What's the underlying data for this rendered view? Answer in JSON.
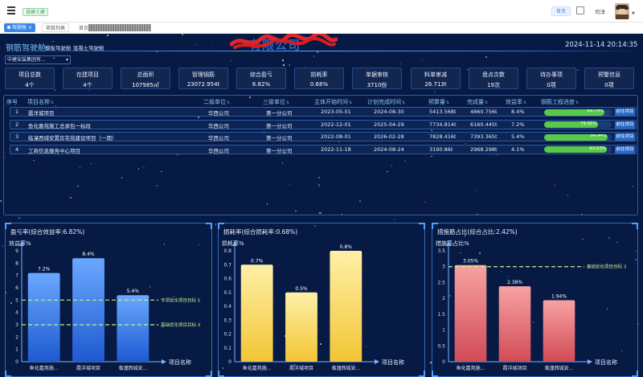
{
  "topbar": {
    "badge": "慧建士建",
    "home": "首页",
    "user": "司洋"
  },
  "tabs": {
    "active": "驾驶舱",
    "list": "项目列表",
    "breadcrumb": "首页 /"
  },
  "header": {
    "title": "钢筋驾驶舱",
    "subtitle": "模板驾驶舱  混凝土驾驶舱",
    "company": "有限公司",
    "time": "2024-11-14 20:14:35"
  },
  "org_select": {
    "value": "中建安装集团有..."
  },
  "kpis": [
    {
      "label": "项目总数",
      "value": "4个"
    },
    {
      "label": "在建项目",
      "value": "4个"
    },
    {
      "label": "总面积",
      "value": "107985㎡"
    },
    {
      "label": "管理钢筋",
      "value": "23072.954t"
    },
    {
      "label": "综合盈亏",
      "value": "6.82%"
    },
    {
      "label": "损耗率",
      "value": "0.68%"
    },
    {
      "label": "单据审核",
      "value": "3710份"
    },
    {
      "label": "料单审减",
      "value": "26.713t"
    },
    {
      "label": "盘点次数",
      "value": "19次"
    },
    {
      "label": "待办事项",
      "value": "0项"
    },
    {
      "label": "预警信息",
      "value": "0项"
    }
  ],
  "table": {
    "headers": {
      "no": "序号",
      "name": "项目名称",
      "unit2": "二级单位",
      "unit3": "三级单位",
      "start": "主体开始时间",
      "plan": "计划完成时间",
      "budget": "预算量",
      "done": "完成量",
      "rate": "效益率",
      "progress": "钢筋工程进度"
    },
    "goto_label": "前往项目",
    "rows": [
      {
        "no": "1",
        "name": "霞洋城项目",
        "unit2": "华西公司",
        "unit3": "第一分公司",
        "start": "2023-05-01",
        "plan": "2024-08-30",
        "budget": "5413.568t",
        "done": "4860.756t",
        "rate": "8.4%",
        "progress": 89.79,
        "progress_text": "89.79%"
      },
      {
        "no": "2",
        "name": "鱼化嘉苑施工总承包一标段",
        "unit2": "华西公司",
        "unit3": "第一分公司",
        "start": "2022-12-01",
        "plan": "2025-04-29",
        "budget": "7734.814t",
        "done": "6160.445t",
        "rate": "7.2%",
        "progress": 79.65,
        "progress_text": "79.65%"
      },
      {
        "no": "3",
        "name": "临潼西城安置房花苑建设项目（一期）",
        "unit2": "华西公司",
        "unit3": "第一分公司",
        "start": "2022-08-01",
        "plan": "2026-02-28",
        "budget": "7828.416t",
        "done": "7393.365t",
        "rate": "5.4%",
        "progress": 94.44,
        "progress_text": "94.44%"
      },
      {
        "no": "4",
        "name": "工商信息服务中心项目",
        "unit2": "华西公司",
        "unit3": "第一分公司",
        "start": "2022-11-18",
        "plan": "2024-08-24",
        "budget": "3190.86t",
        "done": "2968.298t",
        "rate": "4.1%",
        "progress": 93.03,
        "progress_text": "93.03%"
      }
    ]
  },
  "chart_data": [
    {
      "type": "bar",
      "title": "盈亏率(综合效益率:6.82%)",
      "ylabel": "效益率%",
      "xlabel": "项目名称",
      "categories": [
        "鱼化嘉苑施...",
        "霞洋城项目",
        "临潼西城安..."
      ],
      "values": [
        7.2,
        8.4,
        5.4
      ],
      "value_labels": [
        "7.2%",
        "8.4%",
        "5.4%"
      ],
      "ylim": [
        0,
        9
      ],
      "ticks": [
        0,
        1,
        2,
        3,
        4,
        5,
        6,
        7,
        8,
        9
      ],
      "ref_lines": [
        {
          "value": 5,
          "label": "专项优化项目目标 5"
        },
        {
          "value": 3,
          "label": "基础优化项目目标 3"
        }
      ],
      "bar_top": "#6aa8ff",
      "bar_bottom": "#1e5ad0",
      "ref_color": "#c6f08a"
    },
    {
      "type": "bar",
      "title": "损耗率(综合损耗率:0.68%)",
      "ylabel": "损耗率%",
      "xlabel": "项目名称",
      "categories": [
        "鱼化嘉苑施...",
        "霞洋城项目",
        "临潼西城安..."
      ],
      "values": [
        0.7,
        0.5,
        0.8
      ],
      "value_labels": [
        "0.7%",
        "0.5%",
        "0.8%"
      ],
      "ylim": [
        0,
        0.8
      ],
      "ticks": [
        0,
        0.1,
        0.2,
        0.3,
        0.4,
        0.5,
        0.6,
        0.7,
        0.8
      ],
      "ref_lines": [],
      "bar_top": "#fff0a8",
      "bar_bottom": "#f2c534",
      "ref_color": "#c6f08a"
    },
    {
      "type": "bar",
      "title": "措施筋占比(综合占比:2.42%)",
      "ylabel": "措施筋占比%",
      "xlabel": "项目名称",
      "categories": [
        "鱼化嘉苑施...",
        "霞洋城项目",
        "临潼西城安..."
      ],
      "values": [
        3.05,
        2.38,
        1.94
      ],
      "value_labels": [
        "3.05%",
        "2.38%",
        "1.94%"
      ],
      "ylim": [
        0,
        3.5
      ],
      "ticks": [
        0,
        0.5,
        1,
        1.5,
        2,
        2.5,
        3,
        3.5
      ],
      "ref_lines": [
        {
          "value": 3,
          "label": "基础优化项目目标 3"
        }
      ],
      "bar_top": "#f7a2a2",
      "bar_bottom": "#d14b56",
      "ref_color": "#c6f08a"
    }
  ]
}
